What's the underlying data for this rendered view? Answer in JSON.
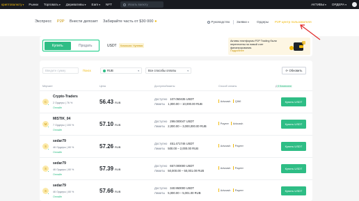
{
  "topbar": {
    "brand": "криптовалюту",
    "items": [
      "Рынки",
      "Торговать",
      "Деривативы",
      "Earn",
      "NFT"
    ],
    "search_placeholder": "Искать валюту",
    "right_items": [
      "АКТИВЫ",
      "ОРДЕРА"
    ]
  },
  "subnav": {
    "tabs": [
      "Экспресс",
      "P2P",
      "Внести депозит",
      "Забирайте часть от $30 000"
    ],
    "active_tab": "P2P",
    "links": [
      "Руководство",
      "Заявки",
      "Ордеры",
      "P2P центр пользователя"
    ]
  },
  "trade": {
    "buy_label": "Купить",
    "sell_label": "Продать",
    "asset": "USDT",
    "asset_badge": "Комиссия: Нулевая",
    "promo_text": "Активы платформы P2P Trading были перенесены на новый счет финансирования.",
    "promo_link": "Подробнее"
  },
  "filters": {
    "amount_placeholder": "Введите сумму",
    "search_link": "Поиск",
    "currency": "RUB",
    "payment": "Все способы оплаты",
    "refresh_label": "Обновить"
  },
  "table": {
    "headers": [
      "Мерчант",
      "Цена",
      "Доступно",
      "Лимиты",
      "Способ оплаты",
      "Действие"
    ],
    "commission_badge": "0 Комиссия",
    "available_label": "Доступно",
    "limits_label": "Лимиты",
    "buy_button": "Купить USDT",
    "rows": [
      {
        "initial": "C",
        "name": "Crypto-Traders",
        "orders": "2 Ордеры",
        "completion": "76 %",
        "status": "Онлайн",
        "price": "56.43",
        "currency": "RUB",
        "available": "107.050435 USDT",
        "limits": "1,000.00 – 10,000.00 RUB",
        "payments": [
          "Advcash",
          "QIWI"
        ]
      },
      {
        "initial": "M",
        "name": "MISTIK_04",
        "orders": "7 Ордеры",
        "completion": "100 %",
        "status": "Онлайн",
        "price": "57.10",
        "currency": "RUB",
        "available": "299.000047 USDT",
        "limits": "2,000.00 – 3,000,000.00 RUB",
        "payments": [
          "Payeer",
          "Advcash"
        ]
      },
      {
        "initial": "S",
        "name": "sedar79",
        "orders": "46 Ордеры",
        "completion": "80 %",
        "status": "Онлайн",
        "price": "57.26",
        "currency": "RUB",
        "available": "451.471746 USDT",
        "limits": "500.00 – 2,000.00 RUB",
        "payments": [
          "Advcash",
          "Payeer"
        ]
      },
      {
        "initial": "S",
        "name": "sedar79",
        "orders": "46 Ордеры",
        "completion": "80 %",
        "status": "Онлайн",
        "price": "57.39",
        "currency": "RUB",
        "available": "657.000000 USDT",
        "limits": "50,000.00 – 50,001.00 RUB",
        "payments": [
          "Advcash",
          "Payeer"
        ]
      },
      {
        "initial": "S",
        "name": "sedar79",
        "orders": "46 Ордеры",
        "completion": "80 %",
        "status": "Онлайн",
        "price": "57.66",
        "currency": "RUB",
        "available": "340.950000 USDT",
        "limits": "5,000.00 – 5,001.00 RUB",
        "payments": [
          "Advcash",
          "Payeer"
        ]
      }
    ]
  },
  "colors": {
    "accent": "#f0b90b",
    "buy_green": "#2ebd85",
    "annotation_red": "#e02828"
  }
}
